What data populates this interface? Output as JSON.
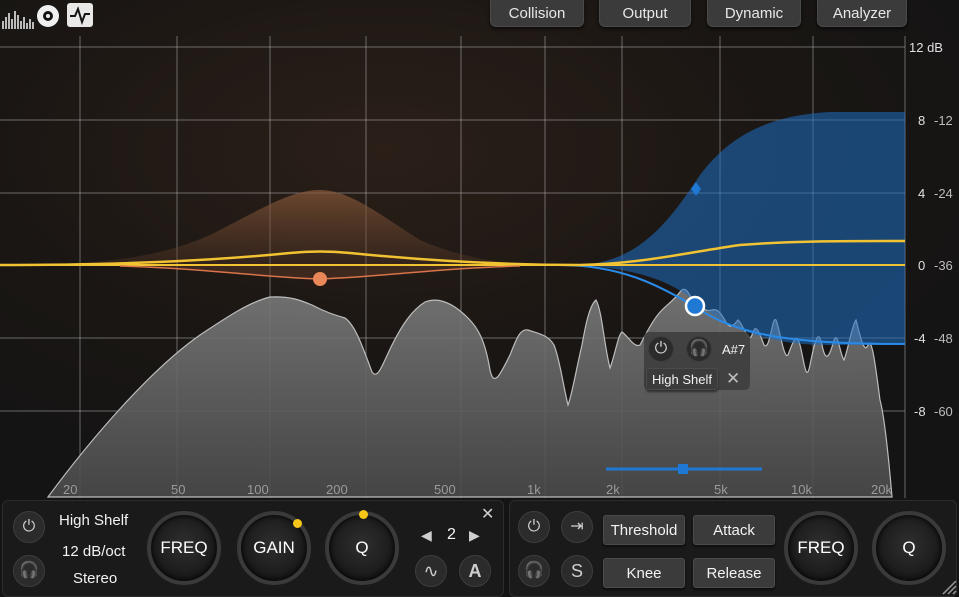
{
  "header": {
    "tabs": [
      {
        "label": "Collision"
      },
      {
        "label": "Output"
      },
      {
        "label": "Dynamic"
      },
      {
        "label": "Analyzer"
      }
    ]
  },
  "graph": {
    "freq_labels": [
      "20",
      "50",
      "100",
      "200",
      "500",
      "1k",
      "2k",
      "5k",
      "10k",
      "20k"
    ],
    "db_labels_left": [
      "12 dB",
      "8",
      "4",
      "0",
      "-4",
      "-8"
    ],
    "db_labels_right": [
      "-12",
      "-24",
      "-36",
      "-48",
      "-60"
    ]
  },
  "band_popup": {
    "note": "A#7",
    "type": "High Shelf",
    "close": "✕"
  },
  "band_panel": {
    "type": "High Shelf",
    "slope": "12 dB/oct",
    "stereo": "Stereo",
    "freq_label": "FREQ",
    "gain_label": "GAIN",
    "q_label": "Q",
    "band_number": "2",
    "prev": "◀",
    "next": "▶",
    "close": "✕"
  },
  "dynamic_panel": {
    "threshold": "Threshold",
    "attack": "Attack",
    "knee": "Knee",
    "release": "Release",
    "freq_label": "FREQ",
    "q_label": "Q",
    "solo": "S"
  },
  "colors": {
    "band1": "#e8875a",
    "band2": "#1e78d4",
    "curve": "#f1c232",
    "spectrum": "#8a8a8a"
  }
}
